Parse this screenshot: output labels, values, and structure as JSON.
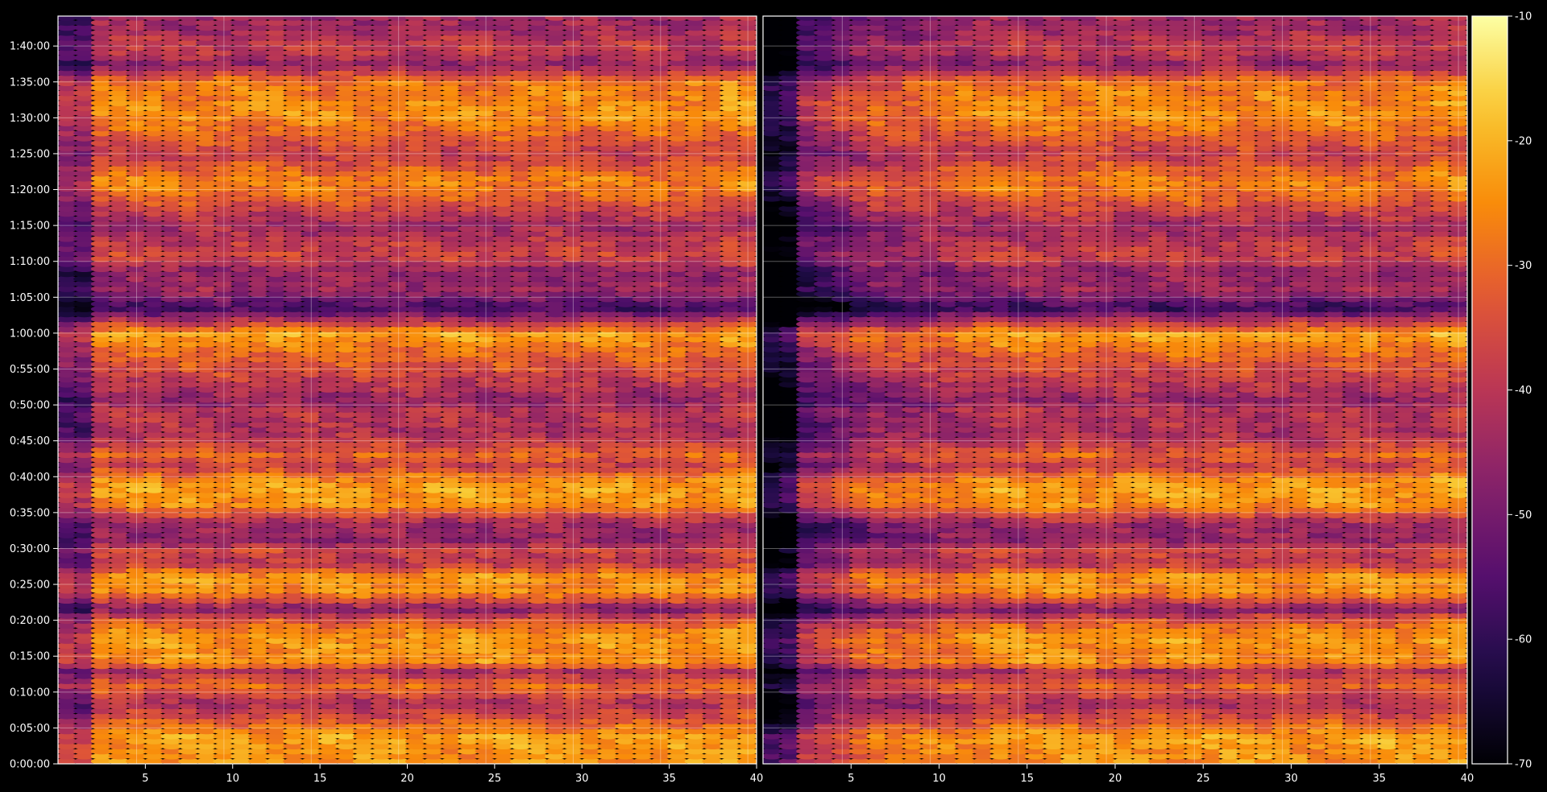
{
  "chart_data": {
    "type": "heatmap",
    "title": "",
    "xlabel": "",
    "ylabel": "",
    "background": "#000000",
    "colormap": "inferno",
    "grid": true,
    "panels": [
      {
        "x_range": [
          1,
          40
        ],
        "x_ticks": [
          5,
          10,
          15,
          20,
          25,
          30,
          35,
          40
        ],
        "x_tick_labels": [
          "5",
          "10",
          "15",
          "20",
          "25",
          "30",
          "35",
          "40"
        ]
      },
      {
        "x_range": [
          1,
          40
        ],
        "x_ticks": [
          5,
          10,
          15,
          20,
          25,
          30,
          35,
          40
        ],
        "x_tick_labels": [
          "5",
          "10",
          "15",
          "20",
          "25",
          "30",
          "35",
          "40"
        ]
      }
    ],
    "y_range_seconds": [
      0,
      6250
    ],
    "y_ticks_seconds": [
      0,
      300,
      600,
      900,
      1200,
      1500,
      1800,
      2100,
      2400,
      2700,
      3000,
      3300,
      3600,
      3900,
      4200,
      4500,
      4800,
      5100,
      5400,
      5700,
      6000
    ],
    "y_tick_labels": [
      "0:00:00",
      "0:05:00",
      "0:10:00",
      "0:15:00",
      "0:20:00",
      "0:25:00",
      "0:30:00",
      "0:35:00",
      "0:40:00",
      "0:45:00",
      "0:50:00",
      "0:55:00",
      "1:00:00",
      "1:05:00",
      "1:10:00",
      "1:15:00",
      "1:20:00",
      "1:25:00",
      "1:30:00",
      "1:35:00",
      "1:40:00"
    ],
    "colorbar": {
      "range": [
        -70,
        -10
      ],
      "ticks": [
        -10,
        -20,
        -30,
        -40,
        -50,
        -60,
        -70
      ],
      "tick_labels": [
        "-10",
        "-20",
        "-30",
        "-40",
        "-50",
        "-60",
        "-70"
      ]
    },
    "row_profile_seconds": [
      [
        100,
        -24
      ],
      [
        220,
        -22
      ],
      [
        360,
        -32
      ],
      [
        500,
        -42
      ],
      [
        650,
        -30
      ],
      [
        780,
        -42
      ],
      [
        840,
        -24
      ],
      [
        950,
        -25
      ],
      [
        1010,
        -23
      ],
      [
        1100,
        -25
      ],
      [
        1220,
        -35
      ],
      [
        1290,
        -48
      ],
      [
        1440,
        -24
      ],
      [
        1500,
        -26
      ],
      [
        1560,
        -22
      ],
      [
        1680,
        -40
      ],
      [
        1790,
        -36
      ],
      [
        1860,
        -46
      ],
      [
        2010,
        -44
      ],
      [
        2160,
        -25
      ],
      [
        2300,
        -22
      ],
      [
        2390,
        -26
      ],
      [
        2490,
        -38
      ],
      [
        2590,
        -30
      ],
      [
        2640,
        -35
      ],
      [
        2760,
        -42
      ],
      [
        2960,
        -40
      ],
      [
        3030,
        -46
      ],
      [
        3260,
        -36
      ],
      [
        3480,
        -28
      ],
      [
        3530,
        -25
      ],
      [
        3590,
        -22
      ],
      [
        3810,
        -58
      ],
      [
        3960,
        -44
      ],
      [
        4120,
        -46
      ],
      [
        4240,
        -36
      ],
      [
        4380,
        -40
      ],
      [
        4500,
        -44
      ],
      [
        4680,
        -34
      ],
      [
        4790,
        -28
      ],
      [
        4880,
        -26
      ],
      [
        5090,
        -38
      ],
      [
        5320,
        -28
      ],
      [
        5430,
        -24
      ],
      [
        5550,
        -26
      ],
      [
        5700,
        -28
      ],
      [
        5850,
        -46
      ],
      [
        5960,
        -38
      ],
      [
        6040,
        -40
      ],
      [
        6140,
        -44
      ]
    ],
    "panel_b_dark_column_band": [
      1,
      7
    ],
    "panel_b_dark_offset_db": -20
  }
}
